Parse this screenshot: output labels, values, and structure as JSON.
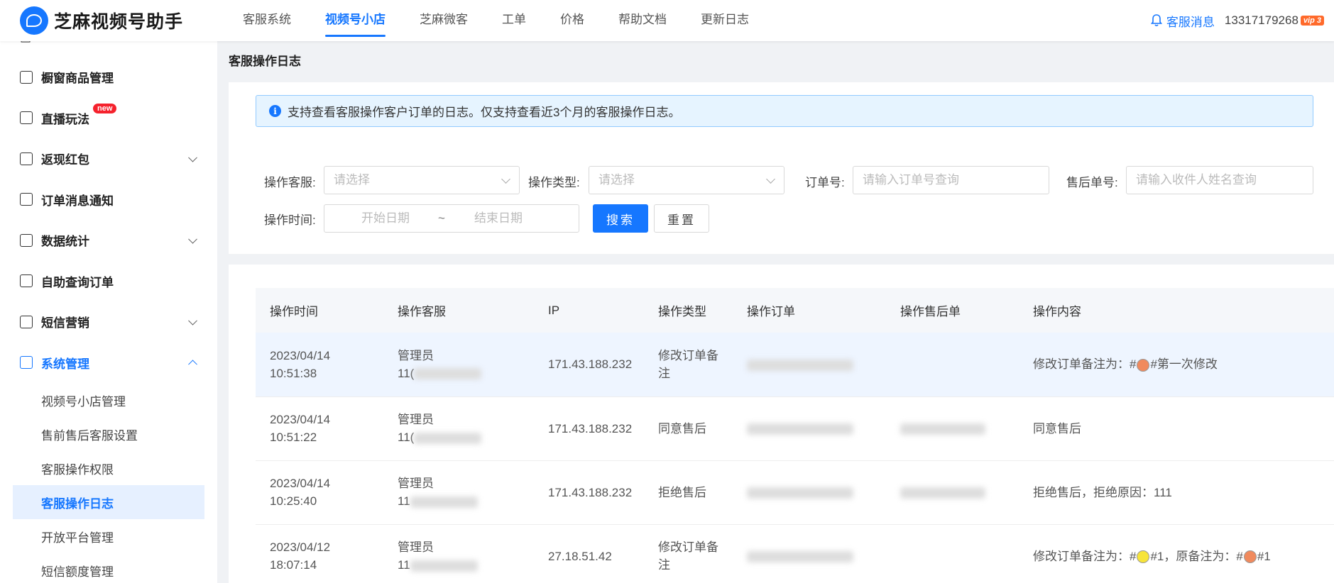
{
  "app": {
    "title": "芝麻视频号助手"
  },
  "nav": {
    "items": [
      "客服系统",
      "视频号小店",
      "芝麻微客",
      "工单",
      "价格",
      "帮助文档",
      "更新日志"
    ],
    "active_index": 1
  },
  "header": {
    "messages_label": "客服消息",
    "phone": "13317179268",
    "vip_badge": "vip 3"
  },
  "sidebar": {
    "items": [
      {
        "label": "橱窗商品管理"
      },
      {
        "label": "直播玩法",
        "badge": "new"
      },
      {
        "label": "返现红包"
      },
      {
        "label": "订单消息通知"
      },
      {
        "label": "数据统计"
      },
      {
        "label": "自助查询订单"
      },
      {
        "label": "短信营销"
      },
      {
        "label": "系统管理"
      }
    ],
    "sub_items": [
      "视频号小店管理",
      "售前售后客服设置",
      "客服操作权限",
      "客服操作日志",
      "开放平台管理",
      "短信额度管理"
    ],
    "active_sub_index": 3
  },
  "page": {
    "title": "客服操作日志",
    "alert": "支持查看客服操作客户订单的日志。仅支持查看近3个月的客服操作日志。"
  },
  "filters": {
    "operator_label": "操作客服:",
    "operator_placeholder": "请选择",
    "type_label": "操作类型:",
    "type_placeholder": "请选择",
    "order_label": "订单号:",
    "order_placeholder": "请输入订单号查询",
    "aftersale_label": "售后单号:",
    "aftersale_placeholder": "请输入收件人姓名查询",
    "time_label": "操作时间:",
    "start_placeholder": "开始日期",
    "range_sep": "~",
    "end_placeholder": "结束日期",
    "search_button": "搜索",
    "reset_button": "重置"
  },
  "table": {
    "columns": [
      "操作时间",
      "操作客服",
      "IP",
      "操作类型",
      "操作订单",
      "操作售后单",
      "操作内容"
    ],
    "rows": [
      {
        "date": "2023/04/14",
        "time": "10:51:38",
        "operator": "管理员",
        "operator_id": "11(",
        "ip": "171.43.188.232",
        "type": "修改订单备注",
        "has_order": true,
        "has_aftersale": false,
        "content_pre": "修改订单备注为：#",
        "dot1": "#f08a5d",
        "content_mid": "#第一次修改",
        "dot2": "",
        "content_post": ""
      },
      {
        "date": "2023/04/14",
        "time": "10:51:22",
        "operator": "管理员",
        "operator_id": "11(",
        "ip": "171.43.188.232",
        "type": "同意售后",
        "has_order": true,
        "has_aftersale": true,
        "content_pre": "同意售后",
        "dot1": "",
        "content_mid": "",
        "dot2": "",
        "content_post": ""
      },
      {
        "date": "2023/04/14",
        "time": "10:25:40",
        "operator": "管理员",
        "operator_id": "11",
        "ip": "171.43.188.232",
        "type": "拒绝售后",
        "has_order": true,
        "has_aftersale": true,
        "content_pre": "拒绝售后，拒绝原因：111",
        "dot1": "",
        "content_mid": "",
        "dot2": "",
        "content_post": ""
      },
      {
        "date": "2023/04/12",
        "time": "18:07:14",
        "operator": "管理员",
        "operator_id": "11",
        "ip": "27.18.51.42",
        "type": "修改订单备注",
        "has_order": true,
        "has_aftersale": false,
        "content_pre": "修改订单备注为：#",
        "dot1": "#f7e43a",
        "content_mid": "#1，原备注为：#",
        "dot2": "#f08a5d",
        "content_post": "#1"
      }
    ]
  },
  "colors": {
    "accent": "#1677ff",
    "new_badge": "#f5222d",
    "vip": "#ff6a2b"
  }
}
